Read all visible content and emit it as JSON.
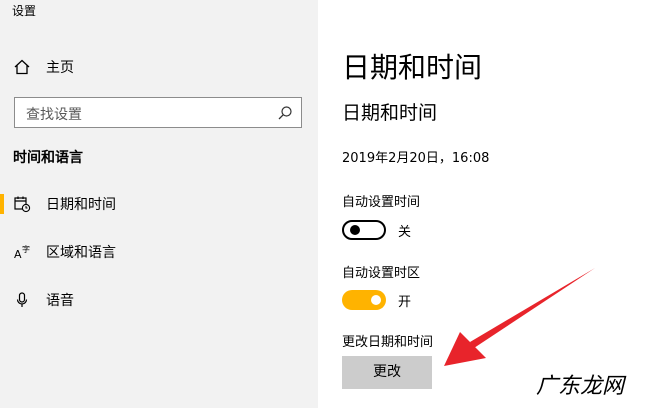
{
  "window": {
    "title": "设置"
  },
  "sidebar": {
    "home_label": "主页",
    "search_placeholder": "查找设置",
    "section_header": "时间和语言",
    "items": [
      {
        "label": "日期和时间",
        "icon": "calendar-clock-icon",
        "selected": true
      },
      {
        "label": "区域和语言",
        "icon": "language-icon",
        "selected": false
      },
      {
        "label": "语音",
        "icon": "microphone-icon",
        "selected": false
      }
    ]
  },
  "main": {
    "page_title": "日期和时间",
    "sub_title": "日期和时间",
    "current_datetime": "2019年2月20日，16:08",
    "auto_time": {
      "label": "自动设置时间",
      "state": "关",
      "on": false
    },
    "auto_timezone": {
      "label": "自动设置时区",
      "state": "开",
      "on": true
    },
    "change_section_label": "更改日期和时间",
    "change_button": "更改"
  },
  "watermark": "广东龙网",
  "colors": {
    "accent": "#ffb300",
    "arrow": "#e8242b",
    "sidebar_bg": "#f2f2f2",
    "button_bg": "#cccccc"
  }
}
